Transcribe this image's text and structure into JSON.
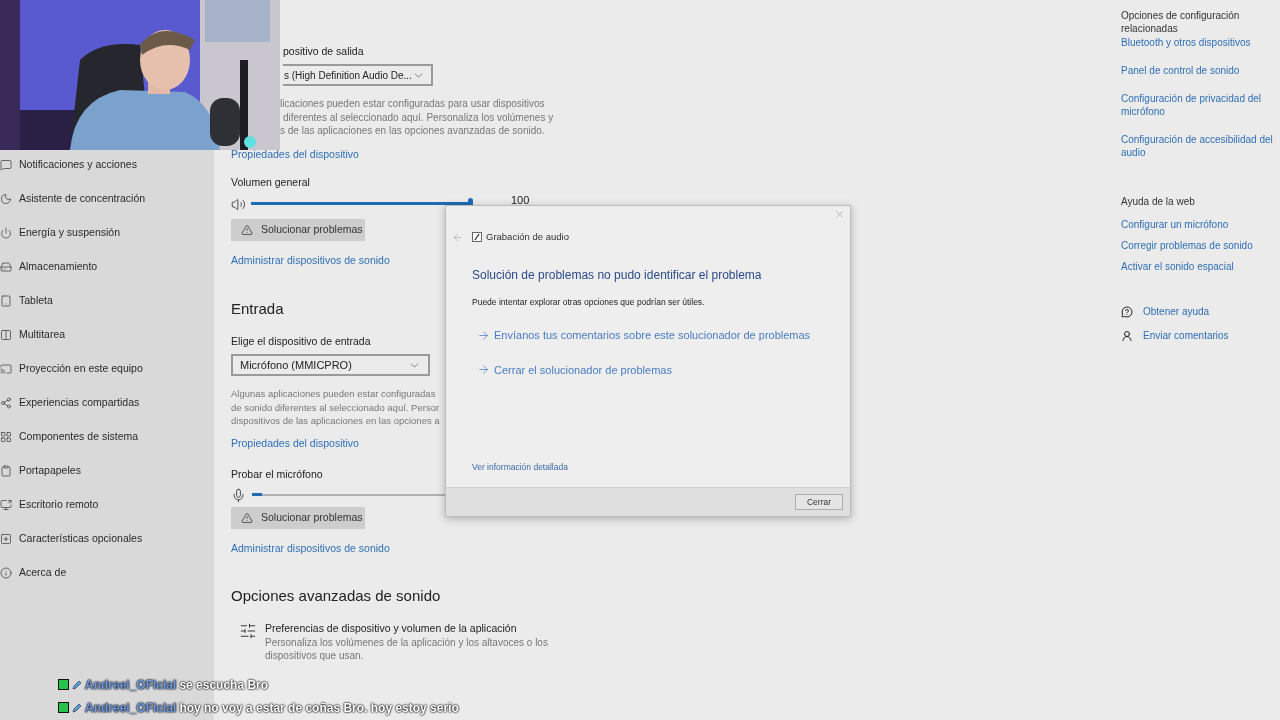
{
  "sidebar": {
    "items": [
      {
        "label": "Notificaciones y acciones"
      },
      {
        "label": "Asistente de concentración"
      },
      {
        "label": "Energía y suspensión"
      },
      {
        "label": "Almacenamiento"
      },
      {
        "label": "Tableta"
      },
      {
        "label": "Multitarea"
      },
      {
        "label": "Proyección en este equipo"
      },
      {
        "label": "Experiencias compartidas"
      },
      {
        "label": "Componentes de sistema"
      },
      {
        "label": "Portapapeles"
      },
      {
        "label": "Escritorio remoto"
      },
      {
        "label": "Características opcionales"
      },
      {
        "label": "Acerca de"
      }
    ]
  },
  "output": {
    "label": "positivo de salida",
    "select_value": "s (High Definition Audio De...",
    "description_lines": [
      "licaciones pueden estar configuradas para usar dispositivos",
      "diferentes al seleccionado aquí. Personaliza los volúmenes y",
      "s de las aplicaciones en las opciones avanzadas de sonido."
    ],
    "link": "Propiedades del dispositivo",
    "volume_label": "Volumen general",
    "volume": {
      "level": 1,
      "reading": "100"
    },
    "troubleshoot_button": "Solucionar problemas",
    "manage_link": "Administrar dispositivos de sonido"
  },
  "input": {
    "heading": "Entrada",
    "label": "Elige el dispositivo de entrada",
    "select_value": "Micrófono (MMICPRO)",
    "description_lines": [
      "Algunas aplicaciones pueden estar configuradas",
      "de sonido diferentes al seleccionado aquí. Persor",
      "dispositivos de las aplicaciones en las opciones a"
    ],
    "link": "Propiedades del dispositivo",
    "test_label": "Probar el micrófono",
    "mic": {
      "level": 0.04
    },
    "troubleshoot_button": "Solucionar problemas",
    "manage_link": "Administrar dispositivos de sonido"
  },
  "advanced": {
    "heading": "Opciones avanzadas de sonido",
    "item": {
      "title": "Preferencias de dispositivo y volumen de la aplicación",
      "description": "Personaliza los volúmenes de la aplicación y los altavoces o los dispositivos que usan."
    }
  },
  "related": {
    "heading": "Opciones de configuración relacionadas",
    "links": [
      "Bluetooth y otros dispositivos",
      "Panel de control de sonido",
      "Configuración de privacidad del micrófono",
      "Configuración de accesibilidad del audio"
    ]
  },
  "web_help": {
    "heading": "Ayuda de la web",
    "links": [
      "Configurar un micrófono",
      "Corregir problemas de sonido",
      "Activar el sonido espacial"
    ]
  },
  "help_actions": [
    {
      "label": "Obtener ayuda"
    },
    {
      "label": "Enviar comentarios"
    }
  ],
  "dialog": {
    "title": "Grabación de audio",
    "heading": "Solución de problemas no pudo identificar el problema",
    "message": "Puede intentar explorar otras opciones que podrían ser útiles.",
    "options": [
      "Envíanos tus comentarios sobre este solucionador de problemas",
      "Cerrar el solucionador de problemas"
    ],
    "details_link": "Ver información detallada",
    "close_button": "Cerrar"
  },
  "chat": [
    {
      "user": "Andreei_OFicial",
      "message": "se escucha Bro"
    },
    {
      "user": "Andreei_OFicial",
      "message": "hoy no voy a estar de coñas Bro. hoy estoy serio"
    }
  ]
}
